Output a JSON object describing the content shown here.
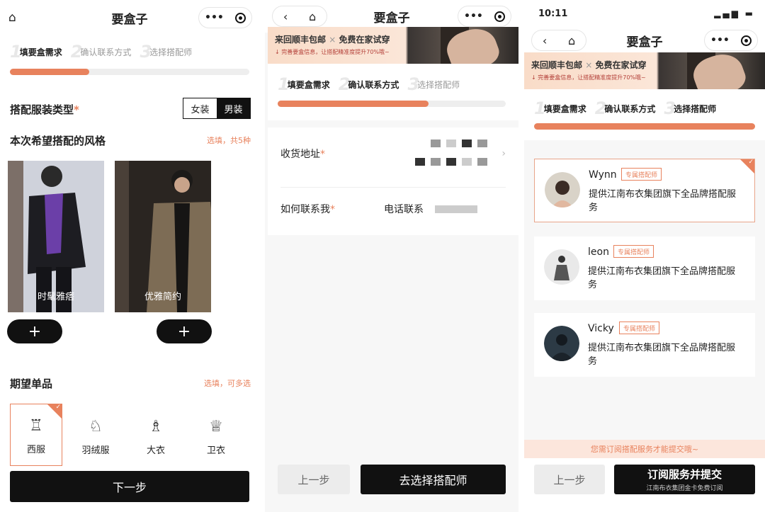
{
  "app_title": "要盒子",
  "steps": [
    "填要盒需求",
    "确认联系方式",
    "选择搭配师"
  ],
  "step_nums": [
    "1",
    "2",
    "3"
  ],
  "progress": {
    "screen1": 0.33,
    "screen2": 0.66,
    "screen3": 1.0
  },
  "accent_color": "#e8825d",
  "screen1": {
    "gender_label": "搭配服装类型",
    "required_mark": "*",
    "gender_options": [
      "女装",
      "男装"
    ],
    "gender_selected": "男装",
    "style_title": "本次希望搭配的风格",
    "style_hint": "选填，共5种",
    "styles": [
      {
        "label": "时髦雅痞"
      },
      {
        "label": "优雅简约"
      }
    ],
    "plus": "+",
    "items_title": "期望单品",
    "items_hint": "选填，可多选",
    "items": [
      {
        "label": "西服",
        "icon": "suit-icon",
        "selected": true
      },
      {
        "label": "羽绒服",
        "icon": "down-jacket-icon",
        "selected": false
      },
      {
        "label": "大衣",
        "icon": "coat-icon",
        "selected": false
      },
      {
        "label": "卫衣",
        "icon": "hoodie-icon",
        "selected": false
      }
    ],
    "next_button": "下一步"
  },
  "banner": {
    "line1": "来回顺丰包邮",
    "sep": "×",
    "line1b": "免费在家试穿",
    "line2": "↓ 完善要盒信息，让搭配精准度提升70%哦~"
  },
  "screen2": {
    "address_label": "收货地址",
    "contact_label": "如何联系我",
    "contact_value": "电话联系",
    "prev_button": "上一步",
    "next_button": "去选择搭配师"
  },
  "screen3": {
    "time": "10:11",
    "stylist_tag": "专属搭配师",
    "stylists": [
      {
        "name": "Wynn",
        "desc": "提供江南布衣集团旗下全品牌搭配服务",
        "selected": true
      },
      {
        "name": "leon",
        "desc": "提供江南布衣集团旗下全品牌搭配服务",
        "selected": false
      },
      {
        "name": "Vicky",
        "desc": "提供江南布衣集团旗下全品牌搭配服务",
        "selected": false
      }
    ],
    "notice": "您需订阅搭配服务才能提交哦~",
    "prev_button": "上一步",
    "submit_button": "订阅服务并提交",
    "submit_sub": "江南布衣集团金卡免费订阅"
  },
  "icons": {
    "home": "home-icon",
    "back": "back-icon",
    "more": "more-icon",
    "target": "target-icon",
    "chevron": "chevron-right-icon"
  }
}
